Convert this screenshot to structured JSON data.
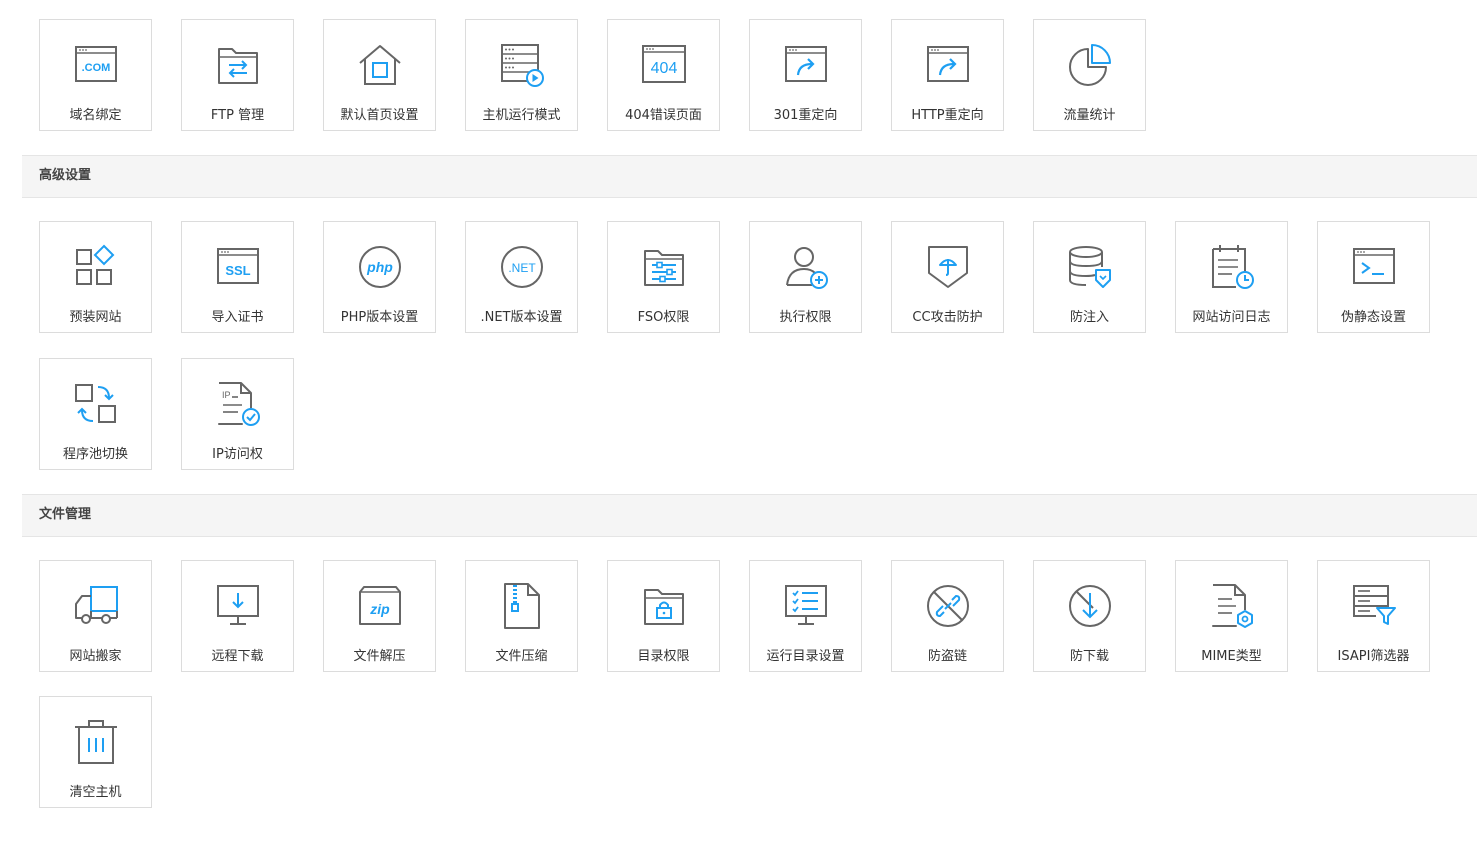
{
  "colors": {
    "icon_gray": "#666666",
    "icon_blue": "#1e9ff2",
    "header_bg": "#f5f5f5",
    "tile_border": "#dcdcdc"
  },
  "basic": {
    "tiles": [
      {
        "label": "域名绑定",
        "icon": "domain-icon"
      },
      {
        "label": "FTP 管理",
        "icon": "ftp-folder-icon"
      },
      {
        "label": "默认首页设置",
        "icon": "home-icon"
      },
      {
        "label": "主机运行模式",
        "icon": "server-run-icon"
      },
      {
        "label": "404错误页面",
        "icon": "error-404-icon"
      },
      {
        "label": "301重定向",
        "icon": "redirect-301-icon"
      },
      {
        "label": "HTTP重定向",
        "icon": "http-redirect-icon"
      },
      {
        "label": "流量统计",
        "icon": "pie-chart-icon"
      }
    ]
  },
  "advanced": {
    "title": "高级设置",
    "tiles": [
      {
        "label": "预装网站",
        "icon": "apps-grid-icon"
      },
      {
        "label": "导入证书",
        "icon": "ssl-icon"
      },
      {
        "label": "PHP版本设置",
        "icon": "php-icon"
      },
      {
        "label": ".NET版本设置",
        "icon": "dotnet-icon"
      },
      {
        "label": "FSO权限",
        "icon": "folder-sliders-icon"
      },
      {
        "label": "执行权限",
        "icon": "user-add-icon"
      },
      {
        "label": "CC攻击防护",
        "icon": "shield-umbrella-icon"
      },
      {
        "label": "防注入",
        "icon": "database-shield-icon"
      },
      {
        "label": "网站访问日志",
        "icon": "log-clock-icon"
      },
      {
        "label": "伪静态设置",
        "icon": "terminal-icon"
      },
      {
        "label": "程序池切换",
        "icon": "pool-switch-icon"
      },
      {
        "label": "IP访问权",
        "icon": "ip-check-icon"
      }
    ]
  },
  "files": {
    "title": "文件管理",
    "tiles": [
      {
        "label": "网站搬家",
        "icon": "truck-icon"
      },
      {
        "label": "远程下载",
        "icon": "monitor-download-icon"
      },
      {
        "label": "文件解压",
        "icon": "zip-icon"
      },
      {
        "label": "文件压缩",
        "icon": "file-zip-icon"
      },
      {
        "label": "目录权限",
        "icon": "folder-lock-icon"
      },
      {
        "label": "运行目录设置",
        "icon": "checklist-monitor-icon"
      },
      {
        "label": "防盗链",
        "icon": "link-block-icon"
      },
      {
        "label": "防下载",
        "icon": "download-block-icon"
      },
      {
        "label": "MIME类型",
        "icon": "file-gear-icon"
      },
      {
        "label": "ISAPI筛选器",
        "icon": "filter-icon"
      },
      {
        "label": "清空主机",
        "icon": "trash-icon"
      }
    ]
  }
}
